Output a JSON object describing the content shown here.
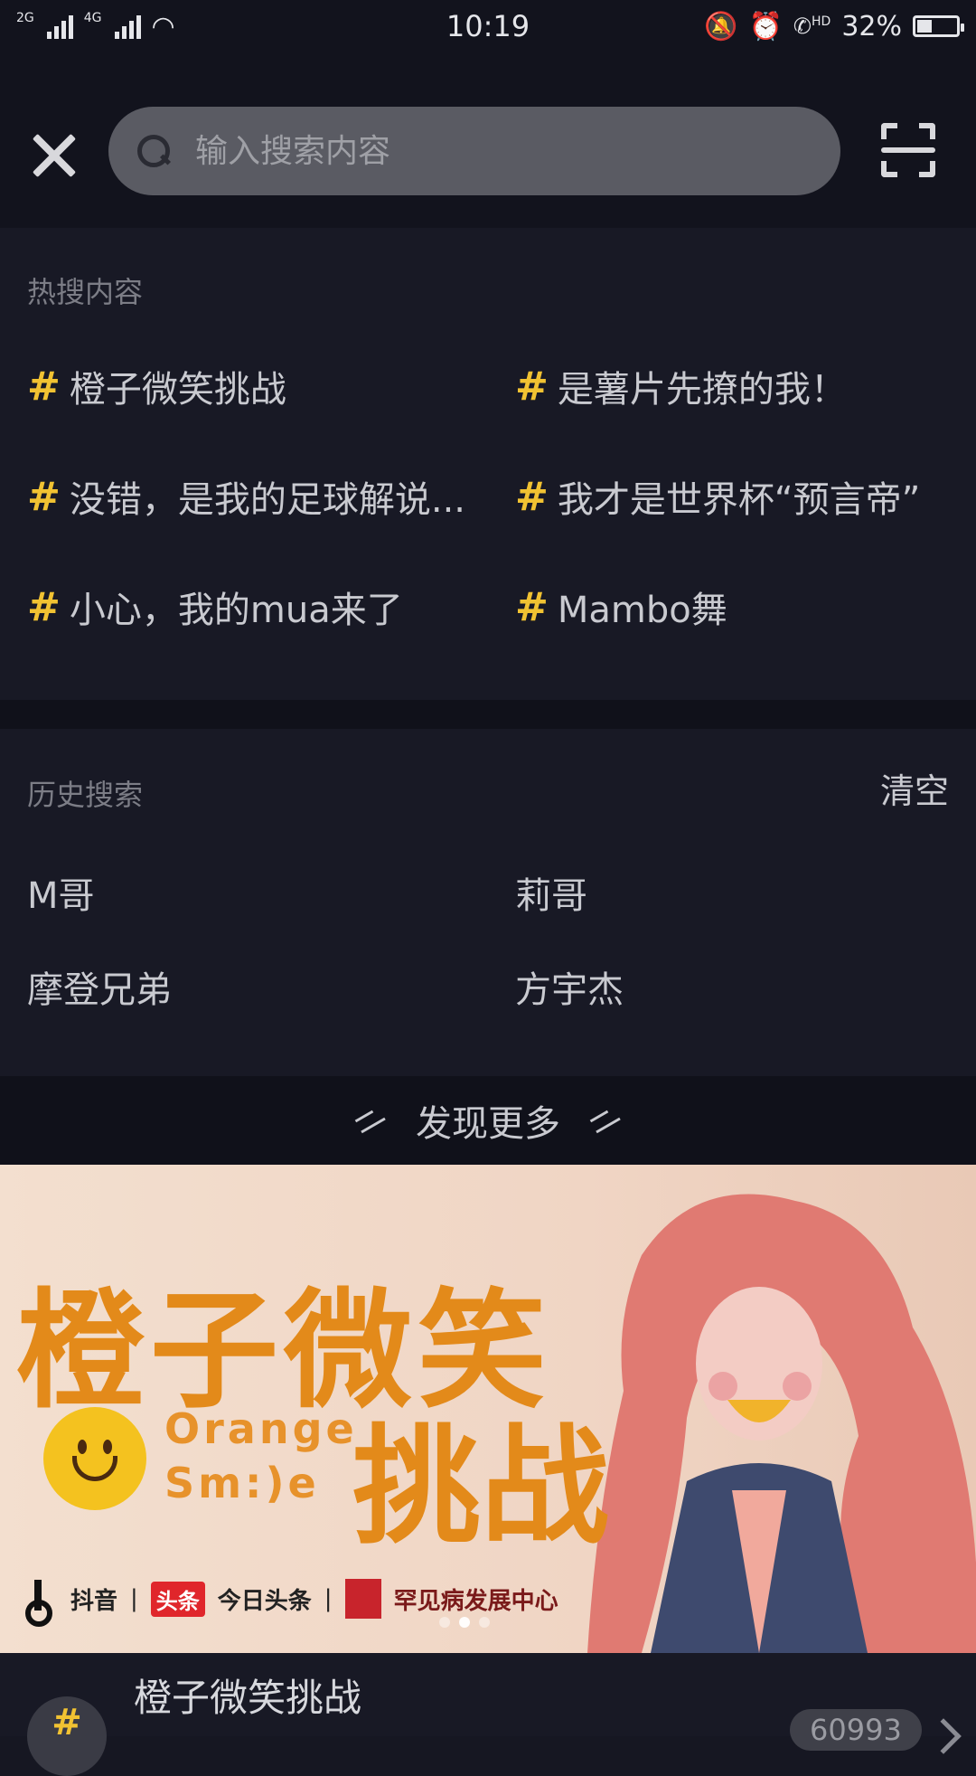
{
  "status_bar": {
    "network1": "2G",
    "network2": "4G",
    "time": "10:19",
    "hd": "HD",
    "battery": "32%"
  },
  "search": {
    "placeholder": "输入搜索内容"
  },
  "hot_search": {
    "title": "热搜内容",
    "items": [
      "橙子微笑挑战",
      "是薯片先撩的我！",
      "没错，是我的足球解说...",
      "我才是世界杯“预言帝”",
      "小心，我的mua来了",
      "Mambo舞"
    ]
  },
  "history": {
    "title": "历史搜索",
    "clear_label": "清空",
    "items": [
      "M哥",
      "莉哥",
      "摩登兄弟",
      "方宇杰"
    ]
  },
  "discover": {
    "label": "发现更多"
  },
  "banner": {
    "title_line1": "橙子微笑",
    "title_line2": "挑战",
    "en_line1": "Orange",
    "en_line2": "Sm:)e",
    "logo_douyin": "抖音",
    "logo_toutiao_badge": "头条",
    "logo_toutiao": "今日头条",
    "logo_rare": "罕见病发展中心",
    "active_slide": 1,
    "slide_count": 3
  },
  "list_row": {
    "title": "橙子微笑挑战",
    "count": "60993"
  },
  "colors": {
    "background": "#161722",
    "accent_hash": "#f1c232",
    "banner_orange": "#e38a1a"
  }
}
